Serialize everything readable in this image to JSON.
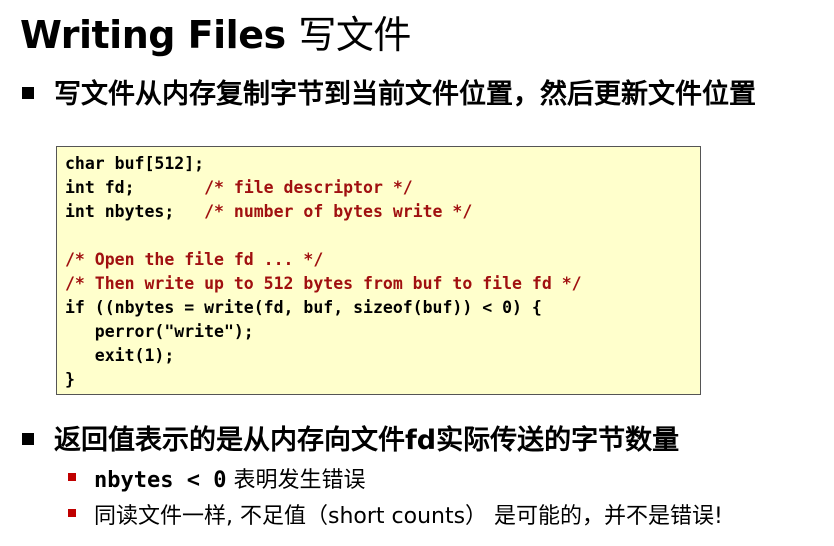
{
  "title": {
    "en": "Writing Files",
    "cn": "写文件"
  },
  "bullets": [
    "写文件从内存复制字节到当前文件位置，然后更新文件位置",
    "返回值表示的是从内存向文件fd实际传送的字节数量"
  ],
  "code": {
    "lines": [
      {
        "code": "char buf[512];",
        "comment": ""
      },
      {
        "code": "int fd;       ",
        "comment": "/* file descriptor */"
      },
      {
        "code": "int nbytes;   ",
        "comment": "/* number of bytes write */"
      },
      {
        "code": "",
        "comment": ""
      },
      {
        "code": "",
        "comment": "/* Open the file fd ... */"
      },
      {
        "code": "",
        "comment": "/* Then write up to 512 bytes from buf to file fd */"
      },
      {
        "code": "if ((nbytes = write(fd, buf, sizeof(buf)) < 0) {",
        "comment": ""
      },
      {
        "code": "   perror(\"write\");",
        "comment": ""
      },
      {
        "code": "   exit(1);",
        "comment": ""
      },
      {
        "code": "}",
        "comment": ""
      }
    ]
  },
  "subbullets": {
    "s1_code": "nbytes < 0",
    "s1_text": " 表明发生错误",
    "s2_text": "同读文件一样, 不足值（short counts） 是可能的，并不是错误!"
  },
  "colors": {
    "code_bg": "#ffffcc",
    "comment": "#a01010",
    "sub_bullet": "#c00000"
  }
}
